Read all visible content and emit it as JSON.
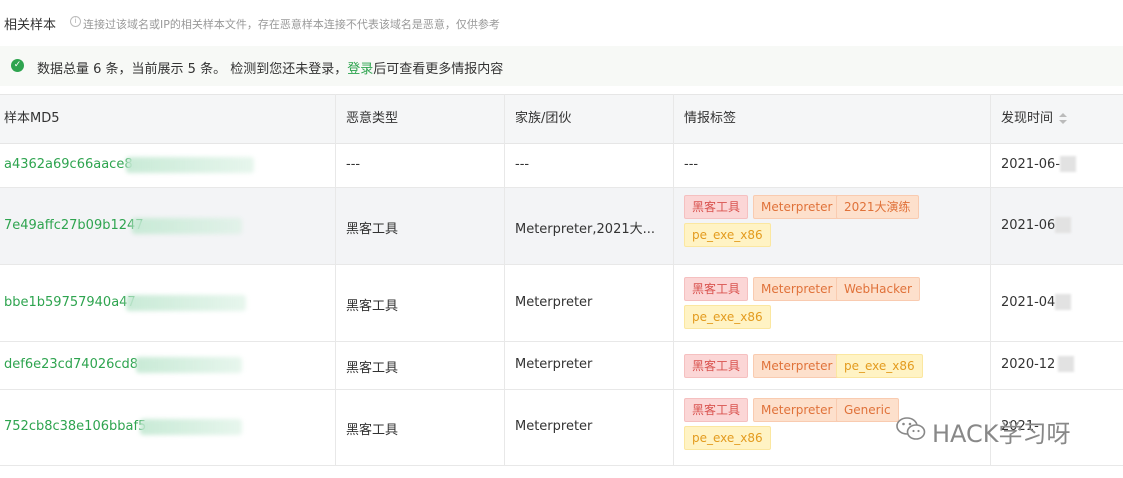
{
  "header": {
    "title": "相关样本",
    "note": "连接过该域名或IP的相关样本文件，存在恶意样本连接不代表该域名是恶意，仅供参考"
  },
  "notice": {
    "text_before": "数据总量 6 条，当前展示 5 条。 检测到您还未登录，",
    "login_link": "登录",
    "text_after": "后可查看更多情报内容"
  },
  "table": {
    "columns": [
      "样本MD5",
      "恶意类型",
      "家族/团伙",
      "情报标签",
      "发现时间"
    ],
    "rows": [
      {
        "md5": "a4362a69c66aace8",
        "type": "---",
        "family": "---",
        "tags_text": "---",
        "time": "2021-06-",
        "tags": []
      },
      {
        "md5": "7e49affc27b09b1247",
        "type": "黑客工具",
        "family": "Meterpreter,2021大...",
        "time": "2021-06",
        "tags": [
          {
            "label": "黑客工具",
            "color": "red"
          },
          {
            "label": "Meterpreter",
            "color": "orange"
          },
          {
            "label": "2021大演练",
            "color": "orange"
          },
          {
            "label": "pe_exe_x86",
            "color": "yellow"
          }
        ]
      },
      {
        "md5": "bbe1b59757940a47",
        "type": "黑客工具",
        "family": "Meterpreter",
        "time": "2021-04",
        "tags": [
          {
            "label": "黑客工具",
            "color": "red"
          },
          {
            "label": "Meterpreter",
            "color": "orange"
          },
          {
            "label": "WebHacker",
            "color": "orange"
          },
          {
            "label": "pe_exe_x86",
            "color": "yellow"
          }
        ]
      },
      {
        "md5": "def6e23cd74026cd8",
        "type": "黑客工具",
        "family": "Meterpreter",
        "time": "2020-12",
        "tags": [
          {
            "label": "黑客工具",
            "color": "red"
          },
          {
            "label": "Meterpreter",
            "color": "orange"
          },
          {
            "label": "pe_exe_x86",
            "color": "yellow"
          }
        ]
      },
      {
        "md5": "752cb8c38e106bbaf5",
        "type": "黑客工具",
        "family": "Meterpreter",
        "time": "2021-",
        "tags": [
          {
            "label": "黑客工具",
            "color": "red"
          },
          {
            "label": "Meterpreter",
            "color": "orange"
          },
          {
            "label": "Generic",
            "color": "orange"
          },
          {
            "label": "pe_exe_x86",
            "color": "yellow"
          }
        ]
      }
    ]
  },
  "watermark": "HACK学习呀",
  "icons": {
    "info": "info-icon",
    "success": "check-circle-icon",
    "sort": "sort-icon",
    "wechat": "wechat-icon"
  },
  "colors": {
    "link_green": "#2ea44f",
    "tag_red": "#d9534f",
    "tag_orange": "#e0723a",
    "tag_yellow": "#e39b1e"
  }
}
